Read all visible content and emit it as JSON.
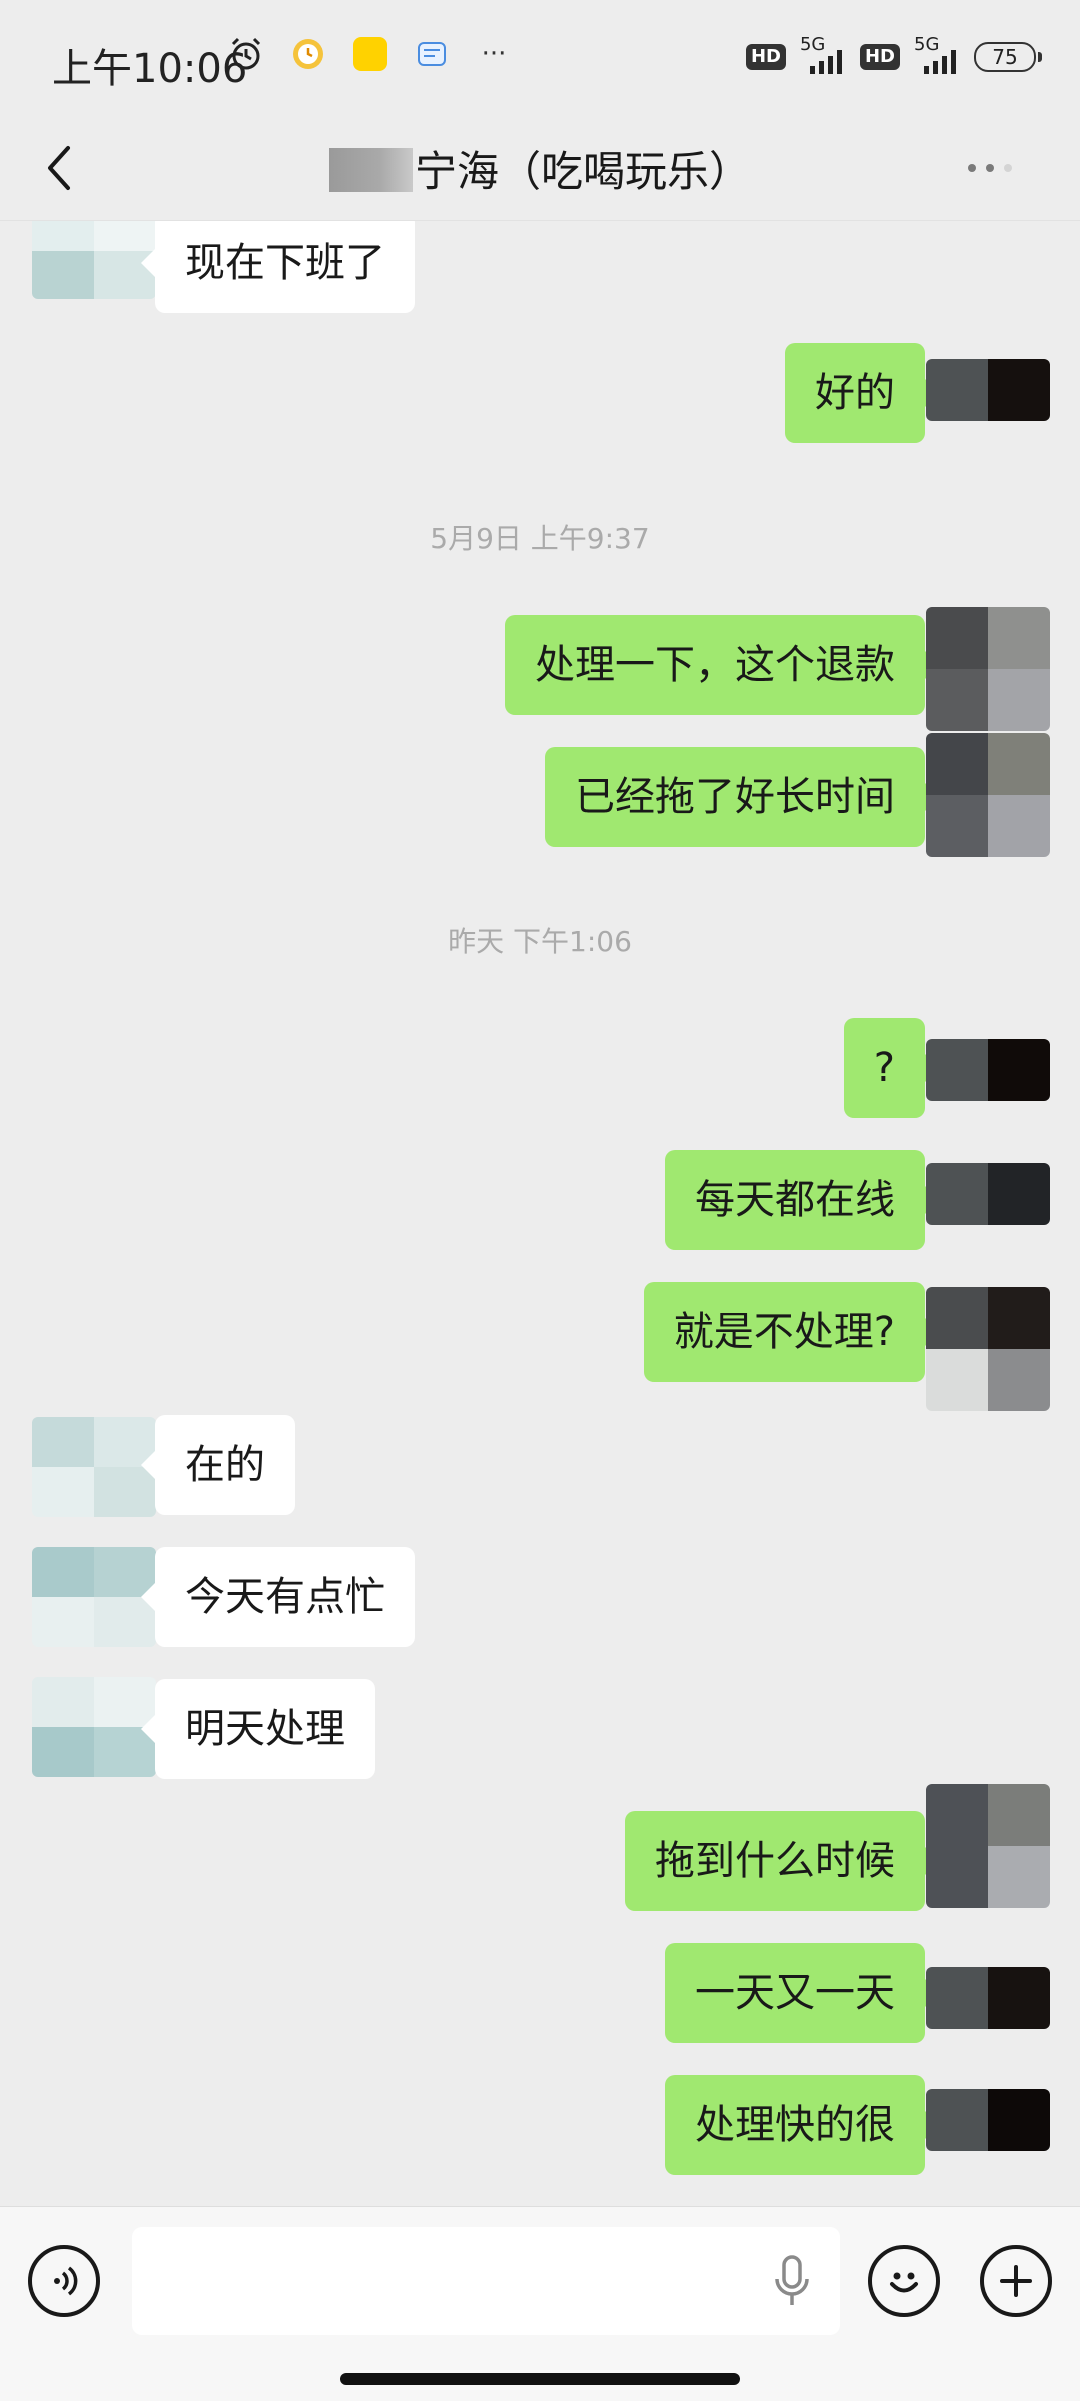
{
  "status_bar": {
    "time": "上午10:06",
    "hd1": "HD",
    "net1": "5G",
    "hd2": "HD",
    "net2": "5G",
    "battery": "75",
    "more": "···"
  },
  "header": {
    "title": "宁海（吃喝玩乐）"
  },
  "messages": [
    {
      "type": "in",
      "text": "现在下班了"
    },
    {
      "type": "out",
      "text": "好的"
    },
    {
      "type": "time",
      "text": "5月9日 上午9:37"
    },
    {
      "type": "out",
      "text": "处理一下，这个退款"
    },
    {
      "type": "out",
      "text": "已经拖了好长时间"
    },
    {
      "type": "time",
      "text": "昨天 下午1:06"
    },
    {
      "type": "out",
      "text": "?"
    },
    {
      "type": "out",
      "text": "每天都在线"
    },
    {
      "type": "out",
      "text": "就是不处理?"
    },
    {
      "type": "in",
      "text": "在的"
    },
    {
      "type": "in",
      "text": "今天有点忙"
    },
    {
      "type": "in",
      "text": "明天处理"
    },
    {
      "type": "out",
      "text": "拖到什么时候"
    },
    {
      "type": "out",
      "text": "一天又一天"
    },
    {
      "type": "out",
      "text": "处理快的很"
    }
  ],
  "input_bar": {
    "value": "",
    "icons": [
      "voice-icon",
      "mic-icon",
      "emoji-icon",
      "plus-icon"
    ]
  },
  "colors": {
    "background": "#ededed",
    "bubble_out": "#a0e870",
    "bubble_in": "#ffffff",
    "timestamp": "#aaaaaa"
  }
}
